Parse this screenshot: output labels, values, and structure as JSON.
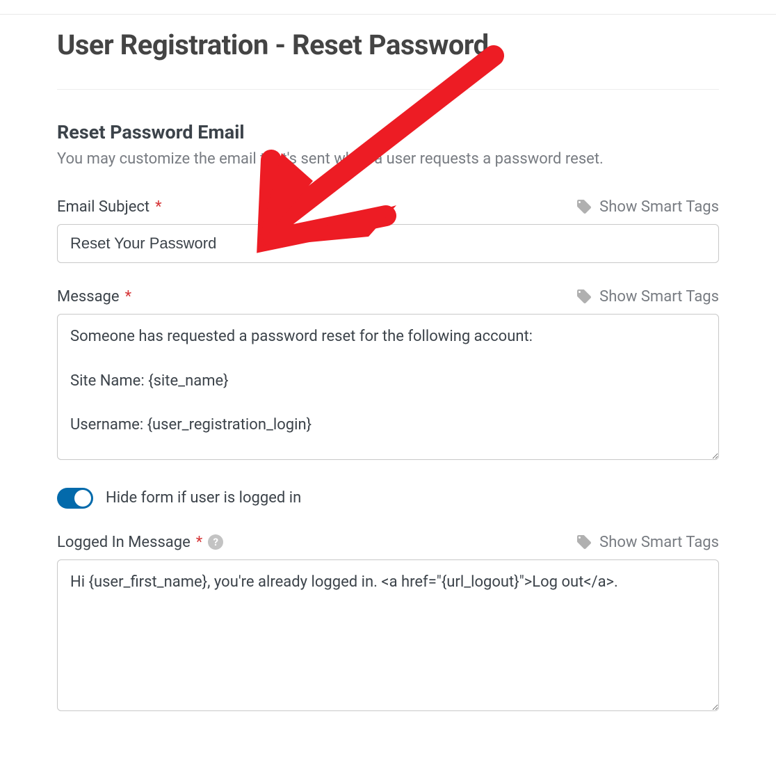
{
  "page": {
    "title": "User Registration - Reset Password"
  },
  "section": {
    "title": "Reset Password Email",
    "description": "You may customize the email that's sent when a user requests a password reset."
  },
  "smart_tags_label": "Show Smart Tags",
  "fields": {
    "email_subject": {
      "label": "Email Subject",
      "value": "Reset Your Password"
    },
    "message": {
      "label": "Message",
      "value": "Someone has requested a password reset for the following account:\n\nSite Name: {site_name}\n\nUsername: {user_registration_login}"
    },
    "hide_toggle": {
      "label": "Hide form if user is logged in",
      "on": true
    },
    "logged_in_message": {
      "label": "Logged In Message",
      "value": "Hi {user_first_name}, you're already logged in. <a href=\"{url_logout}\">Log out</a>."
    }
  }
}
